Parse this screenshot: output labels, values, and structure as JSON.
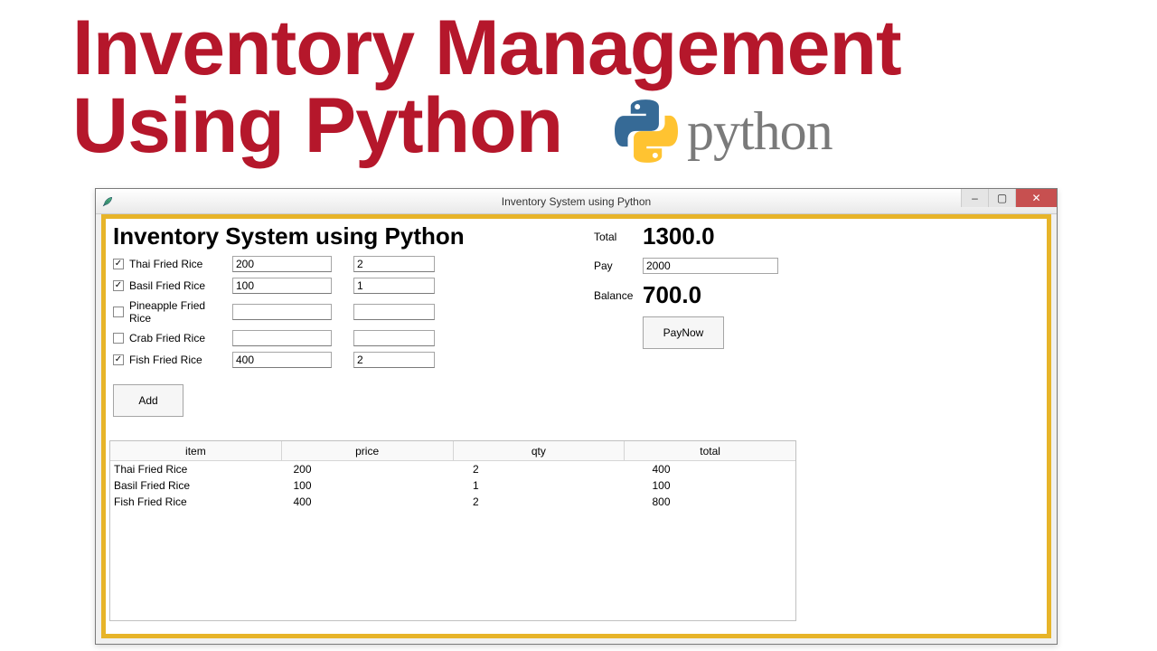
{
  "headline": {
    "line1": "Inventory Management",
    "line2": "Using Python",
    "python_word": "python"
  },
  "window": {
    "title": "Inventory System using Python",
    "minimize": "–",
    "maximize": "▢",
    "close": "✕"
  },
  "app": {
    "title": "Inventory System using Python",
    "add_label": "Add",
    "items": [
      {
        "label": "Thai Fried Rice",
        "checked": true,
        "price": "200",
        "qty": "2"
      },
      {
        "label": "Basil Fried Rice",
        "checked": true,
        "price": "100",
        "qty": "1"
      },
      {
        "label": "Pineapple Fried Rice",
        "checked": false,
        "price": "",
        "qty": ""
      },
      {
        "label": "Crab Fried Rice",
        "checked": false,
        "price": "",
        "qty": ""
      },
      {
        "label": "Fish Fried Rice",
        "checked": true,
        "price": "400",
        "qty": "2"
      }
    ]
  },
  "summary": {
    "total_label": "Total",
    "total_value": "1300.0",
    "pay_label": "Pay",
    "pay_value": "2000",
    "balance_label": "Balance",
    "balance_value": "700.0",
    "paynow_label": "PayNow"
  },
  "table": {
    "headers": [
      "item",
      "price",
      "qty",
      "total"
    ],
    "rows": [
      {
        "item": "Thai Fried Rice",
        "price": "200",
        "qty": "2",
        "total": "400"
      },
      {
        "item": "Basil Fried Rice",
        "price": "100",
        "qty": "1",
        "total": "100"
      },
      {
        "item": "Fish Fried Rice",
        "price": "400",
        "qty": "2",
        "total": "800"
      }
    ]
  }
}
